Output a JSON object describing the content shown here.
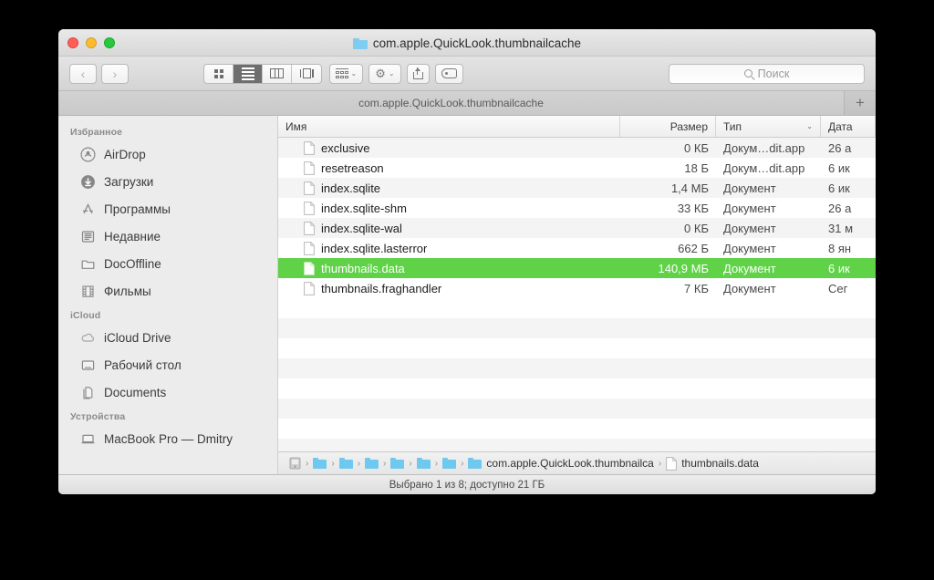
{
  "window": {
    "title": "com.apple.QuickLook.thumbnailcache",
    "traffic_lights": [
      "close",
      "minimize",
      "zoom"
    ]
  },
  "toolbar": {
    "back_label": "‹",
    "forward_label": "›",
    "view_modes": [
      {
        "name": "icon-view",
        "active": false
      },
      {
        "name": "list-view",
        "active": true
      },
      {
        "name": "column-view",
        "active": false
      },
      {
        "name": "gallery-view",
        "active": false
      }
    ],
    "arrange_label": "",
    "action_label": "",
    "share_label": "",
    "tag_label": "",
    "chevron": "⌄"
  },
  "search": {
    "placeholder": "Поиск",
    "value": ""
  },
  "tabs": {
    "items": [
      {
        "label": "com.apple.QuickLook.thumbnailcache",
        "active": true
      }
    ],
    "add_label": "+"
  },
  "sidebar": {
    "sections": [
      {
        "title": "Избранное",
        "items": [
          {
            "label": "AirDrop",
            "icon": "airdrop-icon"
          },
          {
            "label": "Загрузки",
            "icon": "downloads-icon"
          },
          {
            "label": "Программы",
            "icon": "applications-icon"
          },
          {
            "label": "Недавние",
            "icon": "recents-icon"
          },
          {
            "label": "DocOffline",
            "icon": "folder-icon"
          },
          {
            "label": "Фильмы",
            "icon": "movies-icon"
          }
        ]
      },
      {
        "title": "iCloud",
        "items": [
          {
            "label": "iCloud Drive",
            "icon": "cloud-icon"
          },
          {
            "label": "Рабочий стол",
            "icon": "desktop-icon"
          },
          {
            "label": "Documents",
            "icon": "documents-icon"
          }
        ]
      },
      {
        "title": "Устройства",
        "items": [
          {
            "label": "MacBook Pro — Dmitry",
            "icon": "laptop-icon"
          }
        ]
      }
    ]
  },
  "filelist": {
    "columns": [
      {
        "key": "name",
        "label": "Имя"
      },
      {
        "key": "size",
        "label": "Размер"
      },
      {
        "key": "type",
        "label": "Тип",
        "sorted": true,
        "sort_chevron": "⌄"
      },
      {
        "key": "date",
        "label": "Дата"
      }
    ],
    "rows": [
      {
        "name": "exclusive",
        "size": "0 КБ",
        "type": "Докум…dit.app",
        "date": "26 а",
        "selected": false
      },
      {
        "name": "resetreason",
        "size": "18 Б",
        "type": "Докум…dit.app",
        "date": "6 ик",
        "selected": false
      },
      {
        "name": "index.sqlite",
        "size": "1,4 МБ",
        "type": "Документ",
        "date": "6 ик",
        "selected": false
      },
      {
        "name": "index.sqlite-shm",
        "size": "33 КБ",
        "type": "Документ",
        "date": "26 а",
        "selected": false
      },
      {
        "name": "index.sqlite-wal",
        "size": "0 КБ",
        "type": "Документ",
        "date": "31 м",
        "selected": false
      },
      {
        "name": "index.sqlite.lasterror",
        "size": "662 Б",
        "type": "Документ",
        "date": "8 ян",
        "selected": false
      },
      {
        "name": "thumbnails.data",
        "size": "140,9 МБ",
        "type": "Документ",
        "date": "6 ик",
        "selected": true
      },
      {
        "name": "thumbnails.fraghandler",
        "size": "7 КБ",
        "type": "Документ",
        "date": "Сег",
        "selected": false
      }
    ],
    "empty_row_count": 9
  },
  "pathbar": {
    "items": [
      {
        "label": "",
        "icon": "drive-icon"
      },
      {
        "label": "",
        "icon": "folder-icon"
      },
      {
        "label": "",
        "icon": "folder-icon"
      },
      {
        "label": "",
        "icon": "folder-icon"
      },
      {
        "label": "",
        "icon": "folder-icon"
      },
      {
        "label": "",
        "icon": "folder-icon"
      },
      {
        "label": "",
        "icon": "folder-icon"
      },
      {
        "label": "com.apple.QuickLook.thumbnailca",
        "icon": "folder-icon"
      },
      {
        "label": "thumbnails.data",
        "icon": "document-icon"
      }
    ],
    "separator": "›"
  },
  "statusbar": {
    "text": "Выбрано 1 из 8; доступно 21 ГБ"
  },
  "colors": {
    "selection_green": "#5fd247",
    "folder_blue": "#6fc9ef",
    "window_chrome": "#e4e4e4"
  }
}
